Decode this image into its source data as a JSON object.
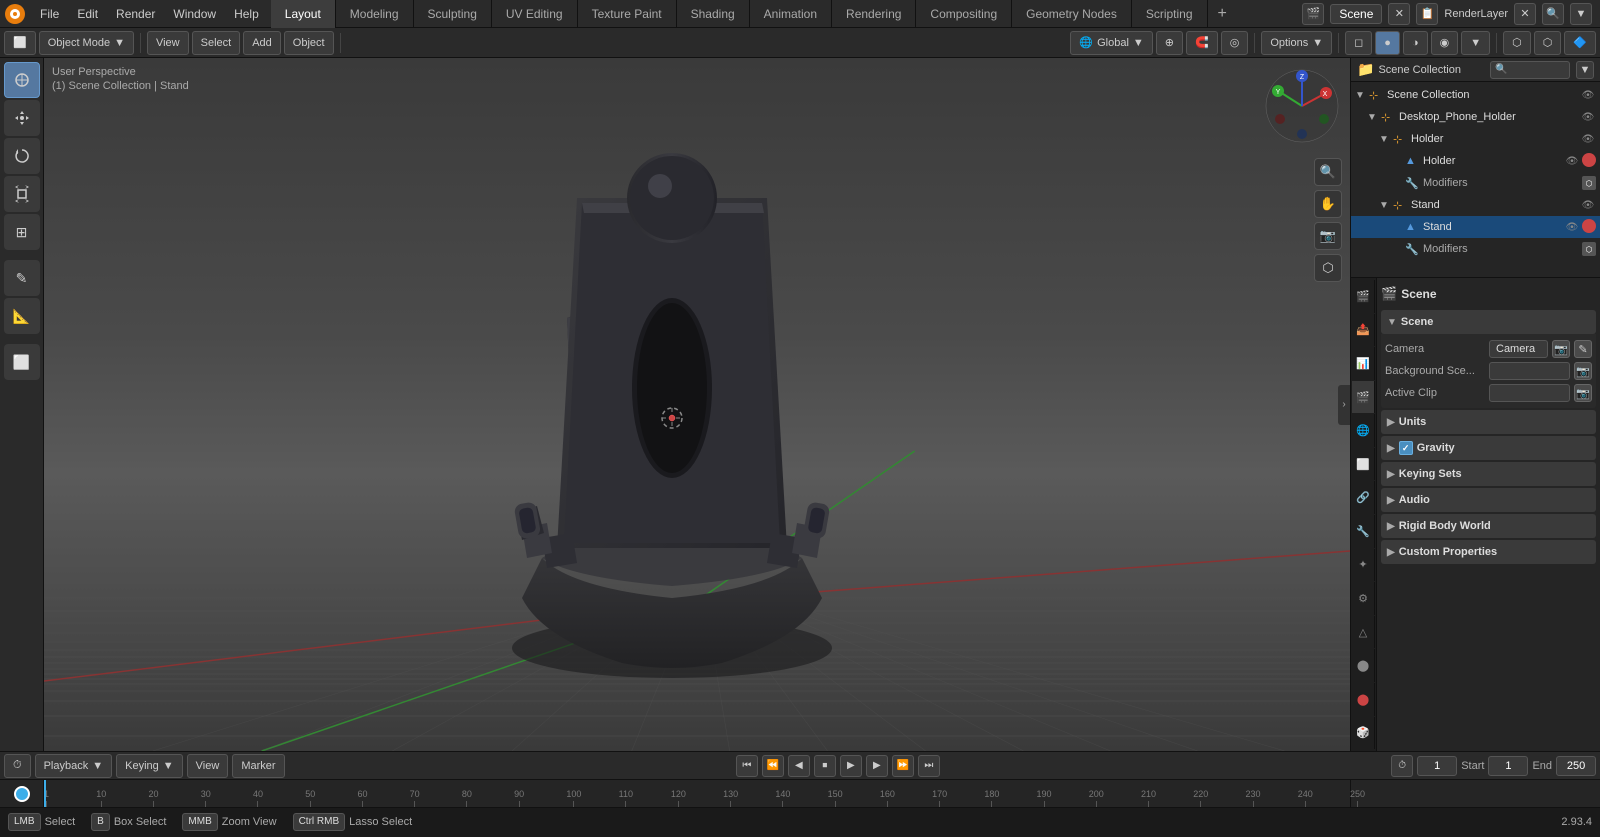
{
  "app": {
    "title": "Blender",
    "version": "2.93.4"
  },
  "top_menu": {
    "items": [
      "File",
      "Edit",
      "Render",
      "Window",
      "Help"
    ]
  },
  "workspace_tabs": {
    "tabs": [
      {
        "label": "Layout",
        "active": true
      },
      {
        "label": "Modeling",
        "active": false
      },
      {
        "label": "Sculpting",
        "active": false
      },
      {
        "label": "UV Editing",
        "active": false
      },
      {
        "label": "Texture Paint",
        "active": false
      },
      {
        "label": "Shading",
        "active": false
      },
      {
        "label": "Animation",
        "active": false
      },
      {
        "label": "Rendering",
        "active": false
      },
      {
        "label": "Compositing",
        "active": false
      },
      {
        "label": "Geometry Nodes",
        "active": false
      },
      {
        "label": "Scripting",
        "active": false
      }
    ]
  },
  "header": {
    "mode": "Object Mode",
    "view_label": "View",
    "select_label": "Select",
    "add_label": "Add",
    "object_label": "Object",
    "transform": "Global",
    "options_label": "Options"
  },
  "viewport": {
    "info_line1": "User Perspective",
    "info_line2": "(1) Scene Collection | Stand"
  },
  "left_tools": [
    {
      "icon": "⊹",
      "name": "cursor-tool",
      "active": true
    },
    {
      "icon": "⊕",
      "name": "move-tool",
      "active": false
    },
    {
      "icon": "↺",
      "name": "rotate-tool",
      "active": false
    },
    {
      "icon": "⊡",
      "name": "scale-tool",
      "active": false
    },
    {
      "icon": "⊞",
      "name": "transform-tool",
      "active": false
    },
    {
      "separator": true
    },
    {
      "icon": "✎",
      "name": "annotate-tool",
      "active": false
    },
    {
      "icon": "📐",
      "name": "measure-tool",
      "active": false
    },
    {
      "separator": true
    },
    {
      "icon": "⊟",
      "name": "cube-tool",
      "active": false
    }
  ],
  "outliner": {
    "header_label": "Scene Collection",
    "items": [
      {
        "label": "Desktop_Phone_Holder",
        "icon": "📁",
        "level": 0,
        "expanded": true,
        "visible": true
      },
      {
        "label": "Holder",
        "icon": "📁",
        "level": 1,
        "expanded": true,
        "visible": true,
        "selected": false
      },
      {
        "label": "Holder",
        "icon": "▲",
        "level": 2,
        "visible": true,
        "has_modifier": true
      },
      {
        "label": "Modifiers",
        "icon": "🔧",
        "level": 2,
        "visible": false
      },
      {
        "label": "Stand",
        "icon": "📁",
        "level": 1,
        "expanded": true,
        "visible": true,
        "selected": true
      },
      {
        "label": "Stand",
        "icon": "▲",
        "level": 2,
        "visible": true,
        "has_modifier": true
      },
      {
        "label": "Modifiers",
        "icon": "🔧",
        "level": 2,
        "visible": false
      }
    ]
  },
  "properties": {
    "active_tab": "scene",
    "tabs": [
      "render",
      "output",
      "view-layer",
      "scene",
      "world",
      "object",
      "constraints",
      "modifier",
      "particles",
      "physics",
      "data",
      "material",
      "shader",
      "render-settings"
    ],
    "scene_label": "Scene",
    "sections": [
      {
        "label": "Scene",
        "expanded": true,
        "rows": [
          {
            "label": "Camera",
            "value": "Camera",
            "has_btn": true
          },
          {
            "label": "Background Sce...",
            "value": "",
            "has_btn": true
          },
          {
            "label": "Active Clip",
            "value": "",
            "has_btn": true
          }
        ]
      },
      {
        "label": "Units",
        "expanded": false
      },
      {
        "label": "Gravity",
        "expanded": false,
        "has_checkbox": true,
        "checkbox_state": true
      },
      {
        "label": "Keying Sets",
        "expanded": false
      },
      {
        "label": "Audio",
        "expanded": false
      },
      {
        "label": "Rigid Body World",
        "expanded": false
      },
      {
        "label": "Custom Properties",
        "expanded": false
      }
    ]
  },
  "timeline": {
    "playback_label": "Playback",
    "keying_label": "Keying",
    "view_label": "View",
    "marker_label": "Marker",
    "current_frame": "1",
    "start_label": "Start",
    "start_value": "1",
    "end_label": "End",
    "end_value": "250"
  },
  "scrubber": {
    "marks": [
      "1",
      "10",
      "20",
      "30",
      "40",
      "50",
      "60",
      "70",
      "80",
      "90",
      "100",
      "110",
      "120",
      "130",
      "140",
      "150",
      "160",
      "170",
      "180",
      "190",
      "200",
      "210",
      "220",
      "230",
      "240",
      "250"
    ]
  },
  "status_bar": {
    "items": [
      {
        "key": "Select",
        "description": "Select"
      },
      {
        "key": "Box Select",
        "description": ""
      },
      {
        "key": "Zoom View",
        "description": ""
      },
      {
        "key": "Lasso Select",
        "description": ""
      }
    ],
    "version": "2.93.4"
  }
}
